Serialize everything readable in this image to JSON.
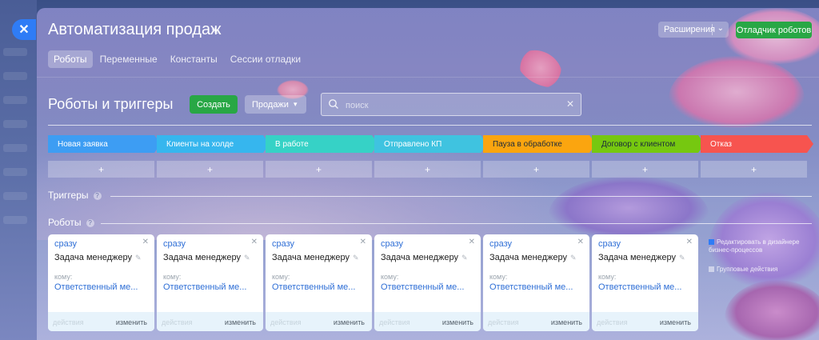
{
  "header": {
    "title": "Автоматизация продаж",
    "extensions_label": "Расширения",
    "debugger_label": "Отладчик роботов"
  },
  "tabs": [
    {
      "label": "Роботы",
      "active": true
    },
    {
      "label": "Переменные",
      "active": false
    },
    {
      "label": "Константы",
      "active": false
    },
    {
      "label": "Сессии отладки",
      "active": false
    }
  ],
  "toolbar": {
    "section_title": "Роботы и триггеры",
    "create_label": "Создать",
    "pipeline_label": "Продажи",
    "search_placeholder": "поиск"
  },
  "stages": [
    {
      "label": "Новая заявка",
      "color": "#3d9df3"
    },
    {
      "label": "Клиенты на холде",
      "color": "#36b6ee"
    },
    {
      "label": "В работе",
      "color": "#36d2c6"
    },
    {
      "label": "Отправлено КП",
      "color": "#3fc3e0"
    },
    {
      "label": "Пауза в обработке",
      "color": "#fba50f"
    },
    {
      "label": "Договор с клиентом",
      "color": "#76c810"
    },
    {
      "label": "Отказ",
      "color": "#f7544f"
    }
  ],
  "add_symbol": "+",
  "triggers_label": "Триггеры",
  "robots_label": "Роботы",
  "help_symbol": "?",
  "robot_cards": [
    {
      "when": "сразу",
      "task": "Задача менеджеру",
      "to_label": "кому:",
      "responsible": "Ответственный ме...",
      "actions_label": "действия",
      "edit_label": "изменить"
    },
    {
      "when": "сразу",
      "task": "Задача менеджеру",
      "to_label": "кому:",
      "responsible": "Ответственный ме...",
      "actions_label": "действия",
      "edit_label": "изменить"
    },
    {
      "when": "сразу",
      "task": "Задача менеджеру",
      "to_label": "кому:",
      "responsible": "Ответственный ме...",
      "actions_label": "действия",
      "edit_label": "изменить"
    },
    {
      "when": "сразу",
      "task": "Задача менеджеру",
      "to_label": "кому:",
      "responsible": "Ответственный ме...",
      "actions_label": "действия",
      "edit_label": "изменить"
    },
    {
      "when": "сразу",
      "task": "Задача менеджеру",
      "to_label": "кому:",
      "responsible": "Ответственный ме...",
      "actions_label": "действия",
      "edit_label": "изменить"
    },
    {
      "when": "сразу",
      "task": "Задача менеджеру",
      "to_label": "кому:",
      "responsible": "Ответственный ме...",
      "actions_label": "действия",
      "edit_label": "изменить"
    }
  ],
  "side_options": {
    "edit_in_designer": "Редактировать в дизайнере бизнес-процессов",
    "group_actions": "Групповые действия"
  },
  "colors": {
    "accent_blue": "#2f7cf6",
    "create_green": "#28a745",
    "link_blue": "#2f6fd6"
  }
}
